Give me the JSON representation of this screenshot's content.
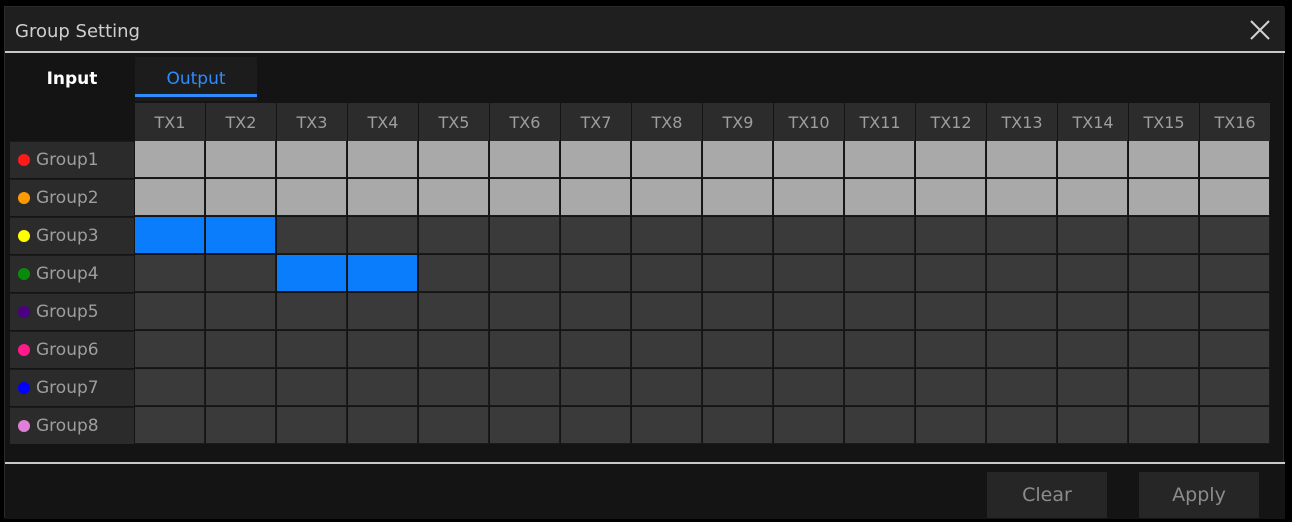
{
  "dialog": {
    "title": "Group Setting"
  },
  "tabs": [
    {
      "label": "Input",
      "active": false
    },
    {
      "label": "Output",
      "active": true
    }
  ],
  "columns": [
    "TX1",
    "TX2",
    "TX3",
    "TX4",
    "TX5",
    "TX6",
    "TX7",
    "TX8",
    "TX9",
    "TX10",
    "TX11",
    "TX12",
    "TX13",
    "TX14",
    "TX15",
    "TX16"
  ],
  "groups": [
    {
      "label": "Group1",
      "color": "#ff1a1a",
      "cells": [
        "used",
        "used",
        "used",
        "used",
        "used",
        "used",
        "used",
        "used",
        "used",
        "used",
        "used",
        "used",
        "used",
        "used",
        "used",
        "used"
      ]
    },
    {
      "label": "Group2",
      "color": "#ff9a00",
      "cells": [
        "used",
        "used",
        "used",
        "used",
        "used",
        "used",
        "used",
        "used",
        "used",
        "used",
        "used",
        "used",
        "used",
        "used",
        "used",
        "used"
      ]
    },
    {
      "label": "Group3",
      "color": "#ffff00",
      "cells": [
        "selected",
        "selected",
        "none",
        "none",
        "none",
        "none",
        "none",
        "none",
        "none",
        "none",
        "none",
        "none",
        "none",
        "none",
        "none",
        "none"
      ]
    },
    {
      "label": "Group4",
      "color": "#0a8a0a",
      "cells": [
        "none",
        "none",
        "selected",
        "selected",
        "none",
        "none",
        "none",
        "none",
        "none",
        "none",
        "none",
        "none",
        "none",
        "none",
        "none",
        "none"
      ]
    },
    {
      "label": "Group5",
      "color": "#4b0082",
      "cells": [
        "none",
        "none",
        "none",
        "none",
        "none",
        "none",
        "none",
        "none",
        "none",
        "none",
        "none",
        "none",
        "none",
        "none",
        "none",
        "none"
      ]
    },
    {
      "label": "Group6",
      "color": "#ff1a8c",
      "cells": [
        "none",
        "none",
        "none",
        "none",
        "none",
        "none",
        "none",
        "none",
        "none",
        "none",
        "none",
        "none",
        "none",
        "none",
        "none",
        "none"
      ]
    },
    {
      "label": "Group7",
      "color": "#0000ff",
      "cells": [
        "none",
        "none",
        "none",
        "none",
        "none",
        "none",
        "none",
        "none",
        "none",
        "none",
        "none",
        "none",
        "none",
        "none",
        "none",
        "none"
      ]
    },
    {
      "label": "Group8",
      "color": "#e07fd8",
      "cells": [
        "none",
        "none",
        "none",
        "none",
        "none",
        "none",
        "none",
        "none",
        "none",
        "none",
        "none",
        "none",
        "none",
        "none",
        "none",
        "none"
      ]
    }
  ],
  "buttons": {
    "clear_label": "Clear",
    "apply_label": "Apply"
  },
  "icons": {
    "close": "close-icon"
  },
  "colors": {
    "accent": "#2f8cff",
    "selected_cell": "#0a7dfc",
    "used_cell": "#a9a9a9",
    "empty_cell": "#3a3a3a"
  }
}
